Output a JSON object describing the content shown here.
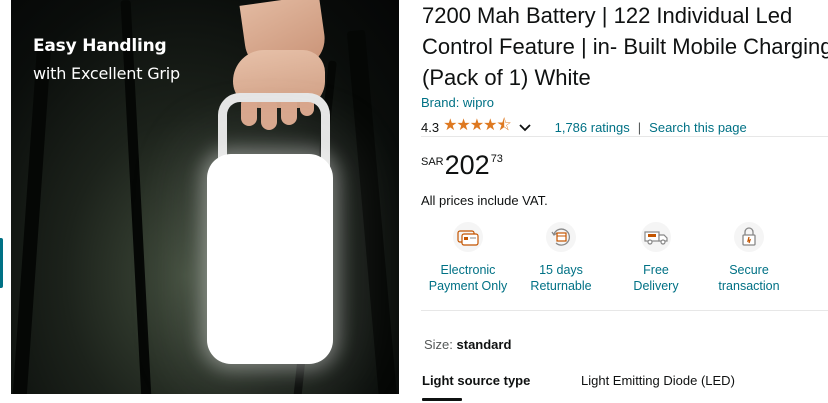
{
  "image": {
    "headline": "Easy Handling",
    "subline": "with Excellent Grip"
  },
  "product": {
    "title_lines": [
      "7200 Mah Battery | 122 Individual Led",
      "Control Feature | in- Built Mobile Charging",
      "(Pack of 1) White"
    ],
    "brand": "Brand: wipro",
    "rating_value": "4.3",
    "stars": "★★★★⯪",
    "ratings_count": "1,786 ratings",
    "separator": "|",
    "search_link": "Search this page",
    "price": {
      "currency": "SAR",
      "whole": "202",
      "fraction": "73"
    },
    "vat_note": "All prices include VAT."
  },
  "features": [
    {
      "icon": "card-payment-icon",
      "line1": "Electronic",
      "line2": "Payment Only"
    },
    {
      "icon": "return-box-icon",
      "line1": "15 days",
      "line2": "Returnable"
    },
    {
      "icon": "delivery-truck-icon",
      "line1": "Free",
      "line2": "Delivery"
    },
    {
      "icon": "secure-lock-icon",
      "line1": "Secure",
      "line2": "transaction"
    }
  ],
  "size": {
    "label": "Size:",
    "value": "standard"
  },
  "spec": {
    "key": "Light source type",
    "value": "Light Emitting Diode (LED)"
  },
  "colors": {
    "link": "#007185",
    "star": "#de7921",
    "text": "#0f1111"
  }
}
